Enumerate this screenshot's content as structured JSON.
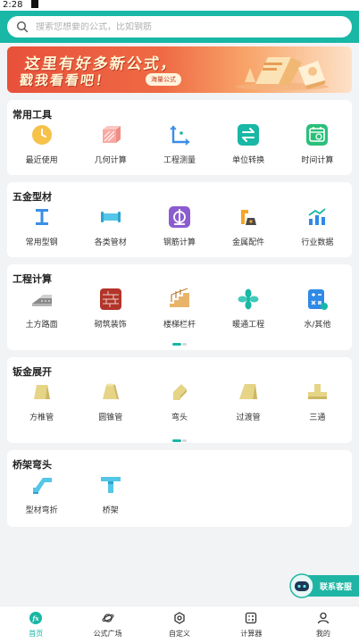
{
  "status_bar": {
    "time": "2:28"
  },
  "search": {
    "placeholder": "搜索您想要的公式，比如钢筋"
  },
  "banner": {
    "line1": "这里有好多新公式，",
    "line2": "戳我看看吧！",
    "tag": "海量公式"
  },
  "sections": [
    {
      "title": "常用工具",
      "items": [
        {
          "label": "最近使用",
          "icon": "clock-icon"
        },
        {
          "label": "几何计算",
          "icon": "geometry-icon"
        },
        {
          "label": "工程测量",
          "icon": "measure-icon"
        },
        {
          "label": "单位转换",
          "icon": "unit-convert-icon"
        },
        {
          "label": "时间计算",
          "icon": "calendar-icon"
        }
      ]
    },
    {
      "title": "五金型材",
      "items": [
        {
          "label": "常用型钢",
          "icon": "i-beam-icon"
        },
        {
          "label": "各类管材",
          "icon": "pipe-icon"
        },
        {
          "label": "钢筋计算",
          "icon": "rebar-icon"
        },
        {
          "label": "金属配件",
          "icon": "metal-parts-icon"
        },
        {
          "label": "行业数据",
          "icon": "chart-icon"
        }
      ]
    },
    {
      "title": "工程计算",
      "items": [
        {
          "label": "土方路面",
          "icon": "road-icon"
        },
        {
          "label": "砌筑装饰",
          "icon": "brick-icon"
        },
        {
          "label": "楼梯栏杆",
          "icon": "stairs-icon"
        },
        {
          "label": "暖通工程",
          "icon": "fan-icon"
        },
        {
          "label": "水/其他",
          "icon": "water-calc-icon"
        }
      ]
    },
    {
      "title": "钣金展开",
      "items": [
        {
          "label": "方椎管",
          "icon": "square-cone-icon"
        },
        {
          "label": "圆锥管",
          "icon": "round-cone-icon"
        },
        {
          "label": "弯头",
          "icon": "elbow-icon"
        },
        {
          "label": "过渡管",
          "icon": "transition-pipe-icon"
        },
        {
          "label": "三通",
          "icon": "tee-icon"
        }
      ]
    },
    {
      "title": "桥架弯头",
      "items": [
        {
          "label": "型材弯折",
          "icon": "profile-bend-icon"
        },
        {
          "label": "桥架",
          "icon": "cable-tray-icon"
        }
      ]
    }
  ],
  "customer_service": {
    "label": "联系客服"
  },
  "tabs": [
    {
      "label": "首页",
      "icon": "fx-icon",
      "active": true
    },
    {
      "label": "公式广场",
      "icon": "planet-icon"
    },
    {
      "label": "自定义",
      "icon": "settings-icon"
    },
    {
      "label": "计算器",
      "icon": "calculator-icon"
    },
    {
      "label": "我的",
      "icon": "user-icon"
    }
  ],
  "colors": {
    "accent": "#19b7a5",
    "banner": "#e8513b"
  }
}
